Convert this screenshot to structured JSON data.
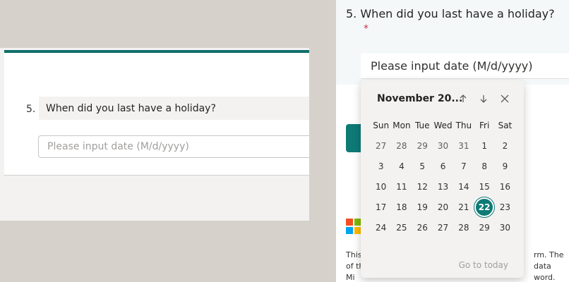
{
  "editor": {
    "question_number": "5.",
    "question_title": "When did you last have a holiday?",
    "date_placeholder": "Please input date (M/d/yyyy)"
  },
  "responder": {
    "question_heading": "5. When did you last have a holiday?",
    "required_marker": "*",
    "date_placeholder": "Please input date (M/d/yyyy)",
    "legal_left": "This\nof th\nMi",
    "legal_right": "rm. The data\nword.",
    "accent_color": "#0e7a76"
  },
  "calendar": {
    "month_label": "November 20...",
    "prev_icon": "arrow-up-icon",
    "next_icon": "arrow-down-icon",
    "close_icon": "close-icon",
    "weekdays": [
      "Sun",
      "Mon",
      "Tue",
      "Wed",
      "Thu",
      "Fri",
      "Sat"
    ],
    "weeks": [
      [
        "27",
        "28",
        "29",
        "30",
        "31",
        "1",
        "2"
      ],
      [
        "3",
        "4",
        "5",
        "6",
        "7",
        "8",
        "9"
      ],
      [
        "10",
        "11",
        "12",
        "13",
        "14",
        "15",
        "16"
      ],
      [
        "17",
        "18",
        "19",
        "20",
        "21",
        "22",
        "23"
      ],
      [
        "24",
        "25",
        "26",
        "27",
        "28",
        "29",
        "30"
      ]
    ],
    "selected_day": "22",
    "go_to_today": "Go to today"
  },
  "colors": {
    "accent": "#0e7a76",
    "required": "#c4314b"
  }
}
